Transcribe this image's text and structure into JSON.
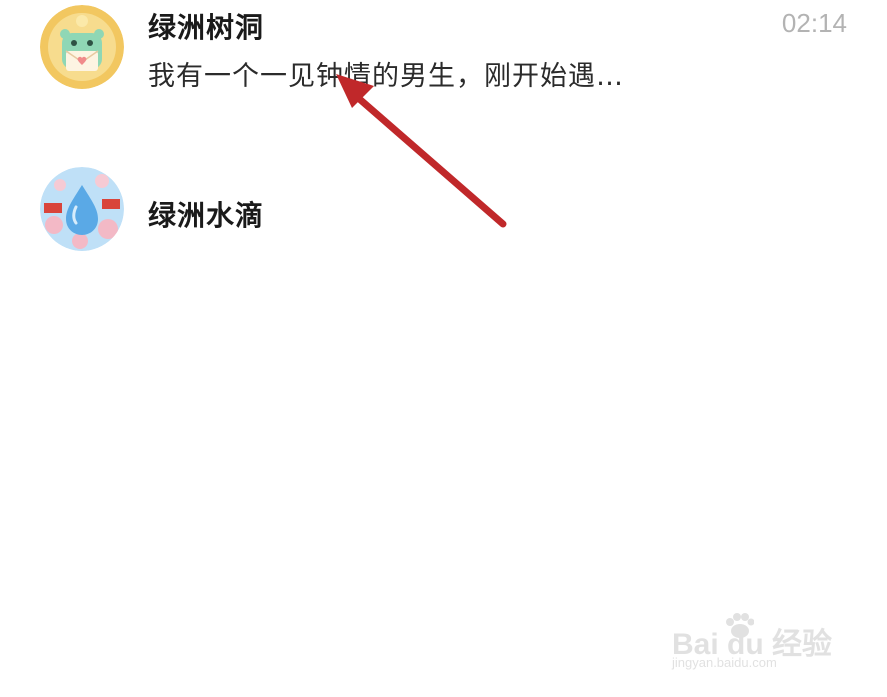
{
  "conversations": [
    {
      "name": "绿洲树洞",
      "preview": "我有一个一见钟情的男生，刚开始遇…",
      "time": "02:14",
      "avatar_icon": "treehole-mascot-avatar",
      "avatar_bg": "#f2c760"
    },
    {
      "name": "绿洲水滴",
      "avatar_icon": "water-drop-mascot-avatar",
      "avatar_bg": "#8fc6f0"
    }
  ],
  "annotation": {
    "arrow_color": "#c0282a"
  },
  "watermark": {
    "brand": "Bai du 经验",
    "url": "jingyan.baidu.com"
  }
}
